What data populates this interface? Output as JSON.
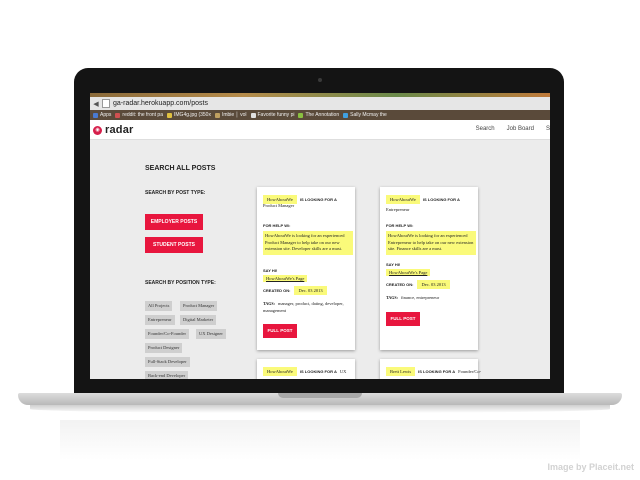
{
  "browser": {
    "url": "ga-radar.herokuapp.com/posts",
    "bookmarks": [
      "Apps",
      "reddit: the front pa",
      "IMG4g.jpg (350x",
      "Imbie │ vol",
      "Favorite funny pi",
      "The Annotation",
      "Sally Mcmay the"
    ]
  },
  "header": {
    "logo": "radar",
    "nav": [
      "Search",
      "Job Board",
      "S"
    ]
  },
  "sidebar": {
    "title": "SEARCH ALL POSTS",
    "by_post_type": "SEARCH BY POST TYPE:",
    "buttons": [
      "EMPLOYER POSTS",
      "STUDENT POSTS"
    ],
    "by_position_type": "SEARCH BY POSITION TYPE:",
    "tags": [
      "All Projects",
      "Product Manager",
      "Entrepreneur",
      "Digital Marketer",
      "Founder/Co-Founder",
      "UX Designer",
      "Product Designer",
      "Full-Stack Developer",
      "Back-end Developer"
    ]
  },
  "cards": [
    {
      "company": "HowAboutWe",
      "looking": "IS LOOKING FOR A",
      "position": "Product Manager",
      "for_help_label": "FOR HELP W/:",
      "description": "HowAboutWe is looking for an experienced Product Manager to help take on our new extension site. Developer skills are a must.",
      "say_hi_label": "SAY HI!",
      "page_link": "HowAboutWe's Page",
      "created_label": "CREATED ON:",
      "created": "Dec. 03 2013",
      "tags_label": "TAGS:",
      "tags": "manager, product, dating, developer, management",
      "button": "FULL POST"
    },
    {
      "company": "HowAboutWe",
      "looking": "IS LOOKING FOR A",
      "position": "Entrepreneur",
      "for_help_label": "FOR HELP W/:",
      "description": "HowAboutWe is looking for an experienced Entrepreneur to help take on our new extension site. Finance skills are a must.",
      "say_hi_label": "SAY HI!",
      "page_link": "HowAboutWe's Page",
      "created_label": "CREATED ON:",
      "created": "Dec. 03 2013",
      "tags_label": "TAGS:",
      "tags": "finance, entrepreneur",
      "button": "FULL POST"
    },
    {
      "company": "HowAboutWe",
      "looking": "IS LOOKING FOR A",
      "position": "UX"
    },
    {
      "company": "Brett Lewis",
      "looking": "IS LOOKING FOR A",
      "position": "Founder/Co-"
    }
  ],
  "watermark": "Image by Placeit.net"
}
